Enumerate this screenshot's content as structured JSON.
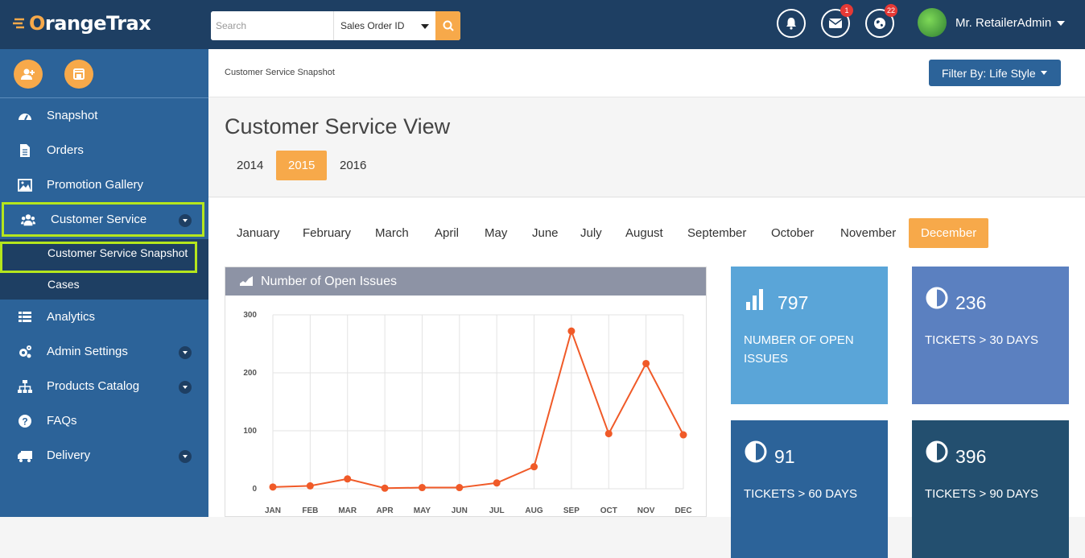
{
  "brand": {
    "name_accent": "O",
    "name_rest": "rangeTrax"
  },
  "search": {
    "placeholder": "Search",
    "type_selected": "Sales Order ID"
  },
  "header": {
    "messages_badge": "1",
    "globe_badge": "22",
    "user_name": "Mr. RetailerAdmin"
  },
  "sidebar": {
    "items": [
      {
        "label": "Snapshot",
        "icon": "dashboard-icon"
      },
      {
        "label": "Orders",
        "icon": "document-icon"
      },
      {
        "label": "Promotion Gallery",
        "icon": "image-icon"
      },
      {
        "label": "Customer Service",
        "icon": "users-icon"
      },
      {
        "label": "Analytics",
        "icon": "list-icon"
      },
      {
        "label": "Admin Settings",
        "icon": "gears-icon"
      },
      {
        "label": "Products Catalog",
        "icon": "sitemap-icon"
      },
      {
        "label": "FAQs",
        "icon": "question-icon"
      },
      {
        "label": "Delivery",
        "icon": "truck-icon"
      }
    ],
    "submenu": [
      "Customer Service Snapshot",
      "Cases"
    ]
  },
  "breadcrumb": "Customer Service Snapshot",
  "filter_button": "Filter By: Life Style",
  "page_title": "Customer Service View",
  "years": [
    "2014",
    "2015",
    "2016"
  ],
  "selected_year": "2015",
  "months": [
    "January",
    "February",
    "March",
    "April",
    "May",
    "June",
    "July",
    "August",
    "September",
    "October",
    "November",
    "December"
  ],
  "selected_month": "December",
  "chart_title": "Number of Open Issues",
  "chart_data": {
    "type": "line",
    "categories": [
      "JAN",
      "FEB",
      "MAR",
      "APR",
      "MAY",
      "JUN",
      "JUL",
      "AUG",
      "SEP",
      "OCT",
      "NOV",
      "DEC"
    ],
    "values": [
      3,
      5,
      17,
      1,
      2,
      2,
      10,
      38,
      272,
      95,
      216,
      93
    ],
    "ylim": [
      0,
      300
    ],
    "yticks": [
      0,
      100,
      200,
      300
    ],
    "color": "#f05a28",
    "grid": true
  },
  "stats": [
    {
      "value": "797",
      "label": "Number of Open Issues",
      "color": "#5aa5d8"
    },
    {
      "value": "236",
      "label": "Tickets > 30 Days",
      "color": "#5b80c0"
    },
    {
      "value": "91",
      "label": "Tickets > 60 Days",
      "color": "#2c6399"
    },
    {
      "value": "396",
      "label": "Tickets > 90 Days",
      "color": "#234f6f"
    }
  ]
}
